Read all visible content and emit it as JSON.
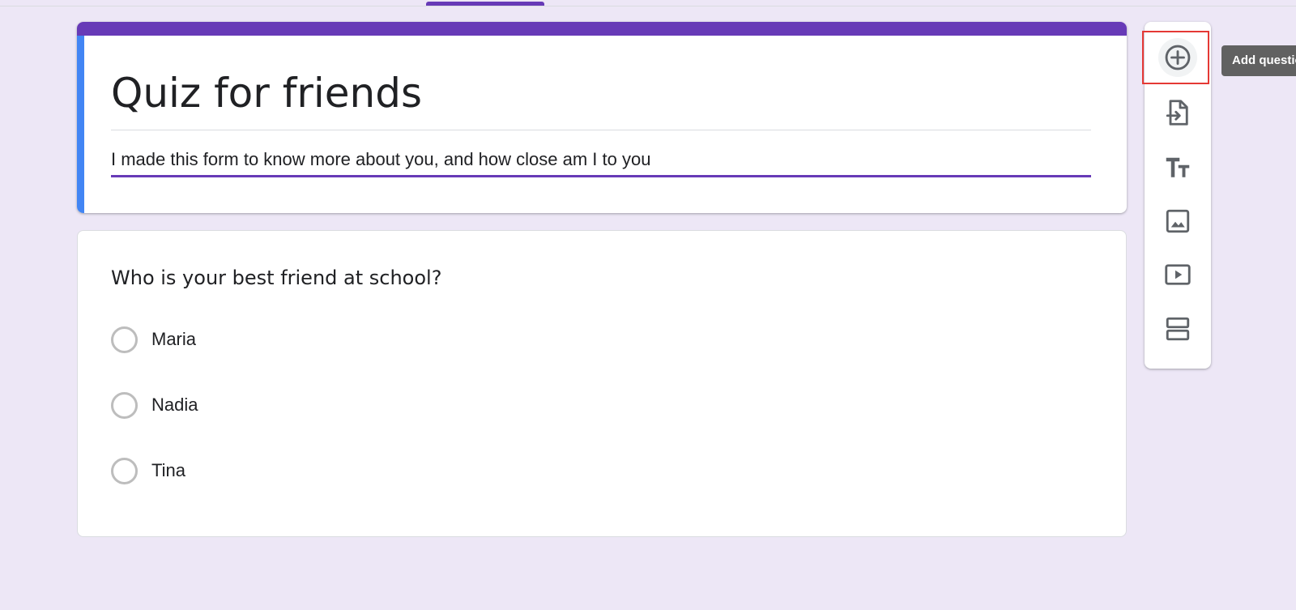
{
  "form": {
    "title": "Quiz for friends",
    "description": "I made this form to know more about you, and how close am I to you"
  },
  "question": {
    "text": "Who is your best friend at school?",
    "options": [
      {
        "label": "Maria"
      },
      {
        "label": "Nadia"
      },
      {
        "label": "Tina"
      }
    ]
  },
  "toolbar": {
    "tooltip": "Add question",
    "tools": [
      {
        "icon": "add-circle-icon"
      },
      {
        "icon": "import-questions-icon"
      },
      {
        "icon": "add-title-icon"
      },
      {
        "icon": "add-image-icon"
      },
      {
        "icon": "add-video-icon"
      },
      {
        "icon": "add-section-icon"
      }
    ]
  },
  "colors": {
    "background": "#ede7f6",
    "accent": "#673ab7",
    "left_accent": "#4285f4",
    "icon": "#5f6368",
    "highlight": "#e53935",
    "tooltip_bg": "#616161"
  }
}
